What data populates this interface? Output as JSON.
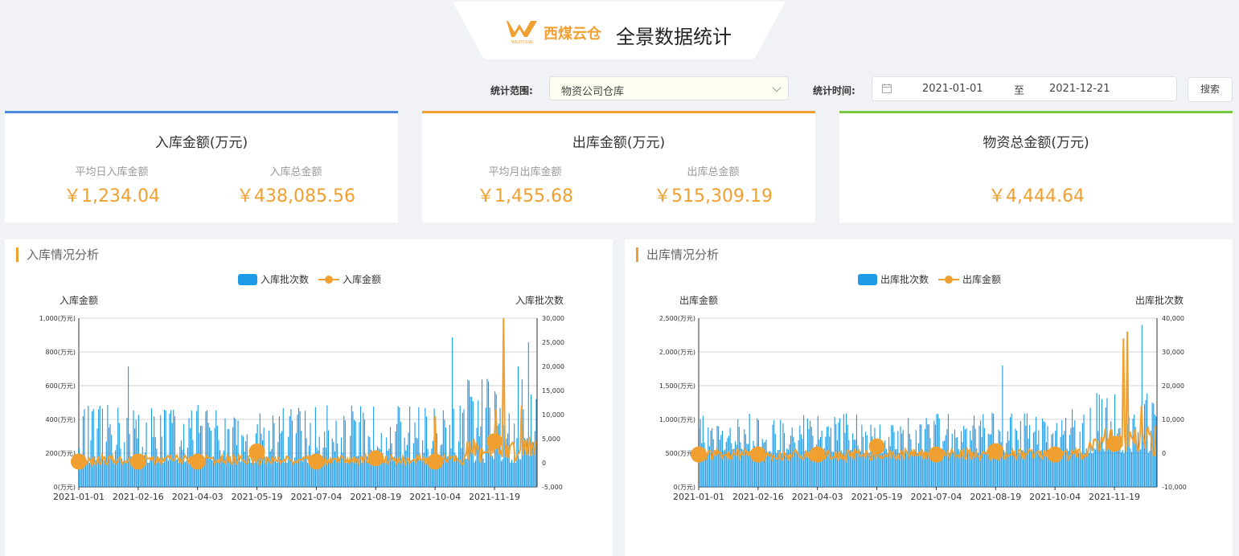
{
  "header": {
    "brand": "西煤云仓",
    "logo_sub": "WESTCOAL",
    "title": "全景数据统计"
  },
  "filters": {
    "range_label": "统计范围:",
    "range_value": "物资公司仓库",
    "time_label": "统计时间:",
    "start_date": "2021-01-01",
    "separator": "至",
    "end_date": "2021-12-21",
    "search_label": "搜索"
  },
  "cards": {
    "inbound": {
      "title": "入库金额(万元)",
      "avg_label": "平均日入库金额",
      "avg_value": "￥1,234.04",
      "total_label": "入库总金额",
      "total_value": "￥438,085.56",
      "accent": "#4a89dc"
    },
    "outbound": {
      "title": "出库金额(万元)",
      "avg_label": "平均月出库金额",
      "avg_value": "￥1,455.68",
      "total_label": "出库总金额",
      "total_value": "￥515,309.19",
      "accent": "#f0a030"
    },
    "materials": {
      "title": "物资总金额(万元)",
      "value": "￥4,444.64",
      "accent": "#7ac943"
    }
  },
  "panels": {
    "inbound_title": "入库情况分析",
    "outbound_title": "出库情况分析"
  },
  "chart_data": [
    {
      "type": "bar",
      "series": [
        {
          "name": "入库批次数",
          "axis": "right",
          "kind": "bar",
          "color": "#1e9be8",
          "range": [
            -5000,
            30000
          ],
          "peaks": {
            "2021-02-08": 20000,
            "2021-04-03": 12000,
            "2021-05-19": 8000,
            "2021-10-17": 26000,
            "2021-12-07": 20000,
            "2021-12-15": 25000
          }
        },
        {
          "name": "入库金额",
          "axis": "left",
          "kind": "line",
          "color": "#f0a030",
          "baseline": 160,
          "peaks": {
            "2021-10-04": 420,
            "2021-11-20": 460,
            "2021-11-26": 1000,
            "2021-12-10": 480
          }
        }
      ],
      "left_axis": {
        "label": "入库金额",
        "ticks": [
          "0(万元)",
          "200(万元)",
          "400(万元)",
          "600(万元)",
          "800(万元)",
          "1,000(万元)"
        ],
        "range": [
          0,
          1000
        ]
      },
      "right_axis": {
        "label": "入库批次数",
        "ticks": [
          "-5,000",
          "0",
          "5,000",
          "10,000",
          "15,000",
          "20,000",
          "25,000",
          "30,000"
        ],
        "range": [
          -5000,
          30000
        ]
      },
      "x_labels": [
        "2021-01-01",
        "2021-02-16",
        "2021-04-03",
        "2021-05-19",
        "2021-07-04",
        "2021-08-19",
        "2021-10-04",
        "2021-11-19"
      ],
      "markers": [
        0,
        46,
        92,
        138,
        184,
        230,
        276,
        322
      ],
      "marker_values": [
        150,
        150,
        150,
        210,
        150,
        170,
        150,
        270
      ]
    },
    {
      "type": "bar",
      "series": [
        {
          "name": "出库批次数",
          "axis": "right",
          "kind": "bar",
          "color": "#1e9be8",
          "range": [
            -10000,
            40000
          ],
          "peaks": {
            "2021-08-24": 26000,
            "2021-10-17": 13000,
            "2021-12-10": 38000
          }
        },
        {
          "name": "出库金额",
          "axis": "left",
          "kind": "line",
          "color": "#f0a030",
          "baseline": 480,
          "peaks": {
            "2021-11-26": 2200,
            "2021-11-29": 2300,
            "2021-12-10": 1200
          }
        }
      ],
      "left_axis": {
        "label": "出库金额",
        "ticks": [
          "0(万元)",
          "500(万元)",
          "1,000(万元)",
          "1,500(万元)",
          "2,000(万元)",
          "2,500(万元)"
        ],
        "range": [
          0,
          2500
        ]
      },
      "right_axis": {
        "label": "出库批次数",
        "ticks": [
          "-10,000",
          "0",
          "10,000",
          "20,000",
          "30,000",
          "40,000"
        ],
        "range": [
          -10000,
          40000
        ]
      },
      "x_labels": [
        "2021-01-01",
        "2021-02-16",
        "2021-04-03",
        "2021-05-19",
        "2021-07-04",
        "2021-08-19",
        "2021-10-04",
        "2021-11-19"
      ],
      "markers": [
        0,
        46,
        92,
        138,
        184,
        230,
        276,
        322
      ],
      "marker_values": [
        480,
        480,
        480,
        600,
        480,
        530,
        480,
        640
      ]
    }
  ]
}
